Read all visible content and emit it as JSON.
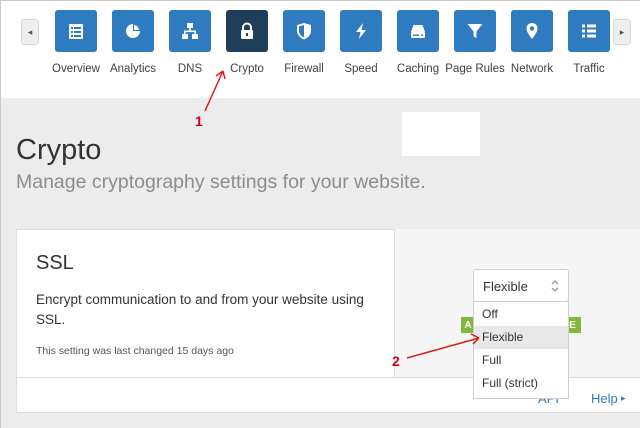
{
  "nav": {
    "prev_arrow": "◂",
    "next_arrow": "▸",
    "items": [
      {
        "label": "Overview",
        "icon": "overview-icon"
      },
      {
        "label": "Analytics",
        "icon": "analytics-icon"
      },
      {
        "label": "DNS",
        "icon": "dns-icon"
      },
      {
        "label": "Crypto",
        "icon": "lock-icon",
        "active": true
      },
      {
        "label": "Firewall",
        "icon": "shield-icon"
      },
      {
        "label": "Speed",
        "icon": "lightning-icon"
      },
      {
        "label": "Caching",
        "icon": "drive-icon"
      },
      {
        "label": "Page Rules",
        "icon": "filter-icon"
      },
      {
        "label": "Network",
        "icon": "location-icon"
      },
      {
        "label": "Traffic",
        "icon": "list-icon"
      }
    ]
  },
  "page": {
    "title": "Crypto",
    "subtitle": "Manage cryptography settings for your website."
  },
  "ssl_card": {
    "title": "SSL",
    "description": "Encrypt communication to and from your website using SSL.",
    "last_changed": "This setting was last changed 15 days ago",
    "badge_left": "A",
    "badge_right": "E",
    "api_label": "API",
    "help_label": "Help",
    "help_arrow": "▸",
    "select": {
      "value": "Flexible",
      "options": [
        "Off",
        "Flexible",
        "Full",
        "Full (strict)"
      ],
      "selected_index": 1
    }
  },
  "annotations": {
    "step1": "1",
    "step2": "2"
  },
  "colors": {
    "nav_tile": "#2f7bbf",
    "nav_tile_active": "#1f3e5c",
    "accent_green": "#82b83a",
    "annotation_red": "#d0021b"
  }
}
